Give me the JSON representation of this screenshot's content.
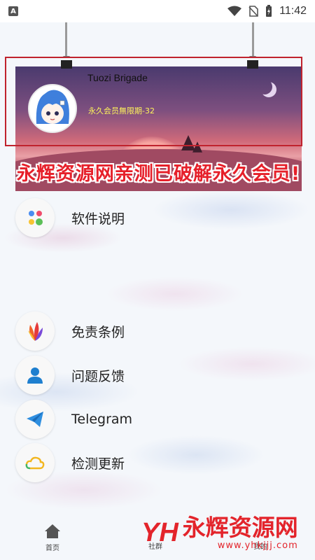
{
  "status_bar": {
    "time": "11:42",
    "left_badge": "A",
    "icons": [
      "wifi-icon",
      "no-sim-icon",
      "battery-charging-icon"
    ]
  },
  "header": {
    "profile_name": "Tuozi Brigade",
    "membership": "永久会员無限期-32",
    "promo_text": "永辉资源网亲测已破解永久会员!"
  },
  "menu": {
    "items": [
      {
        "label": "软件说明",
        "icon": "dots-icon"
      },
      {
        "label": "免责条例",
        "icon": "petal-icon"
      },
      {
        "label": "问题反馈",
        "icon": "person-icon"
      },
      {
        "label": "Telegram",
        "icon": "paper-plane-icon"
      },
      {
        "label": "检测更新",
        "icon": "cloud-icon"
      }
    ]
  },
  "bottom_nav": {
    "home_label": "首页",
    "middle_label": "社群",
    "right_label": "我的"
  },
  "watermark": {
    "logo": "YH",
    "title": "永辉资源网",
    "url": "www.yhkjjj.com"
  },
  "colors": {
    "accent_red": "#e3242b",
    "banner_top": "#4a3a6e",
    "membership_yellow": "#fff45a"
  }
}
